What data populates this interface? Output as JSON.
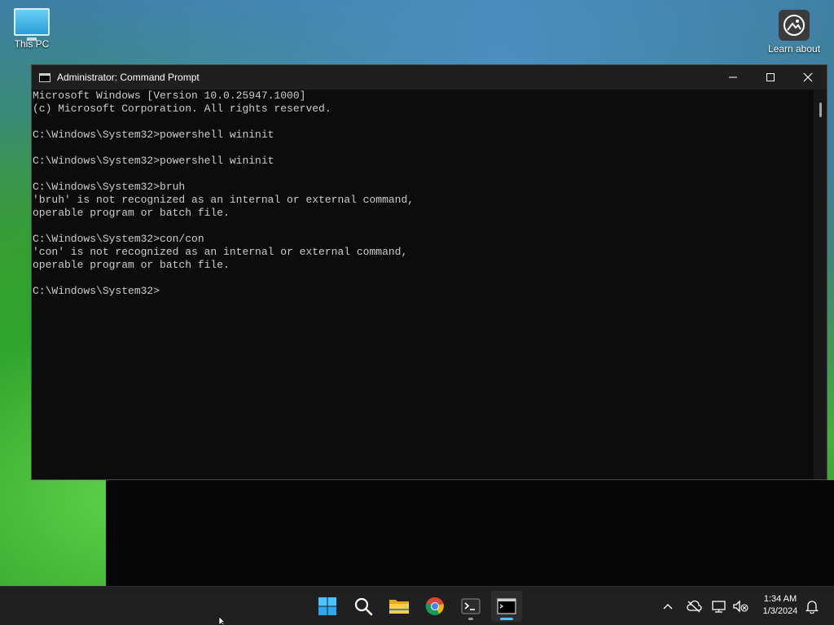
{
  "desktop": {
    "icons": [
      {
        "label": "This PC"
      },
      {
        "label": "Learn about"
      }
    ]
  },
  "window": {
    "title": "Administrator: Command Prompt",
    "console_lines": [
      "Microsoft Windows [Version 10.0.25947.1000]",
      "(c) Microsoft Corporation. All rights reserved.",
      "",
      "C:\\Windows\\System32>powershell wininit",
      "",
      "C:\\Windows\\System32>powershell wininit",
      "",
      "C:\\Windows\\System32>bruh",
      "'bruh' is not recognized as an internal or external command,",
      "operable program or batch file.",
      "",
      "C:\\Windows\\System32>con/con",
      "'con' is not recognized as an internal or external command,",
      "operable program or batch file.",
      "",
      "C:\\Windows\\System32>"
    ]
  },
  "taskbar": {
    "apps": [
      {
        "icon": "windows-start-icon"
      },
      {
        "icon": "search-icon"
      },
      {
        "icon": "file-explorer-icon"
      },
      {
        "icon": "chrome-icon"
      },
      {
        "icon": "terminal-icon"
      },
      {
        "icon": "command-prompt-icon"
      }
    ],
    "clock": {
      "time": "1:34 AM",
      "date": "1/3/2024"
    }
  },
  "colors": {
    "accent": "#4cc2ff",
    "console_text": "#cccccc",
    "console_bg": "#0c0c0c"
  }
}
